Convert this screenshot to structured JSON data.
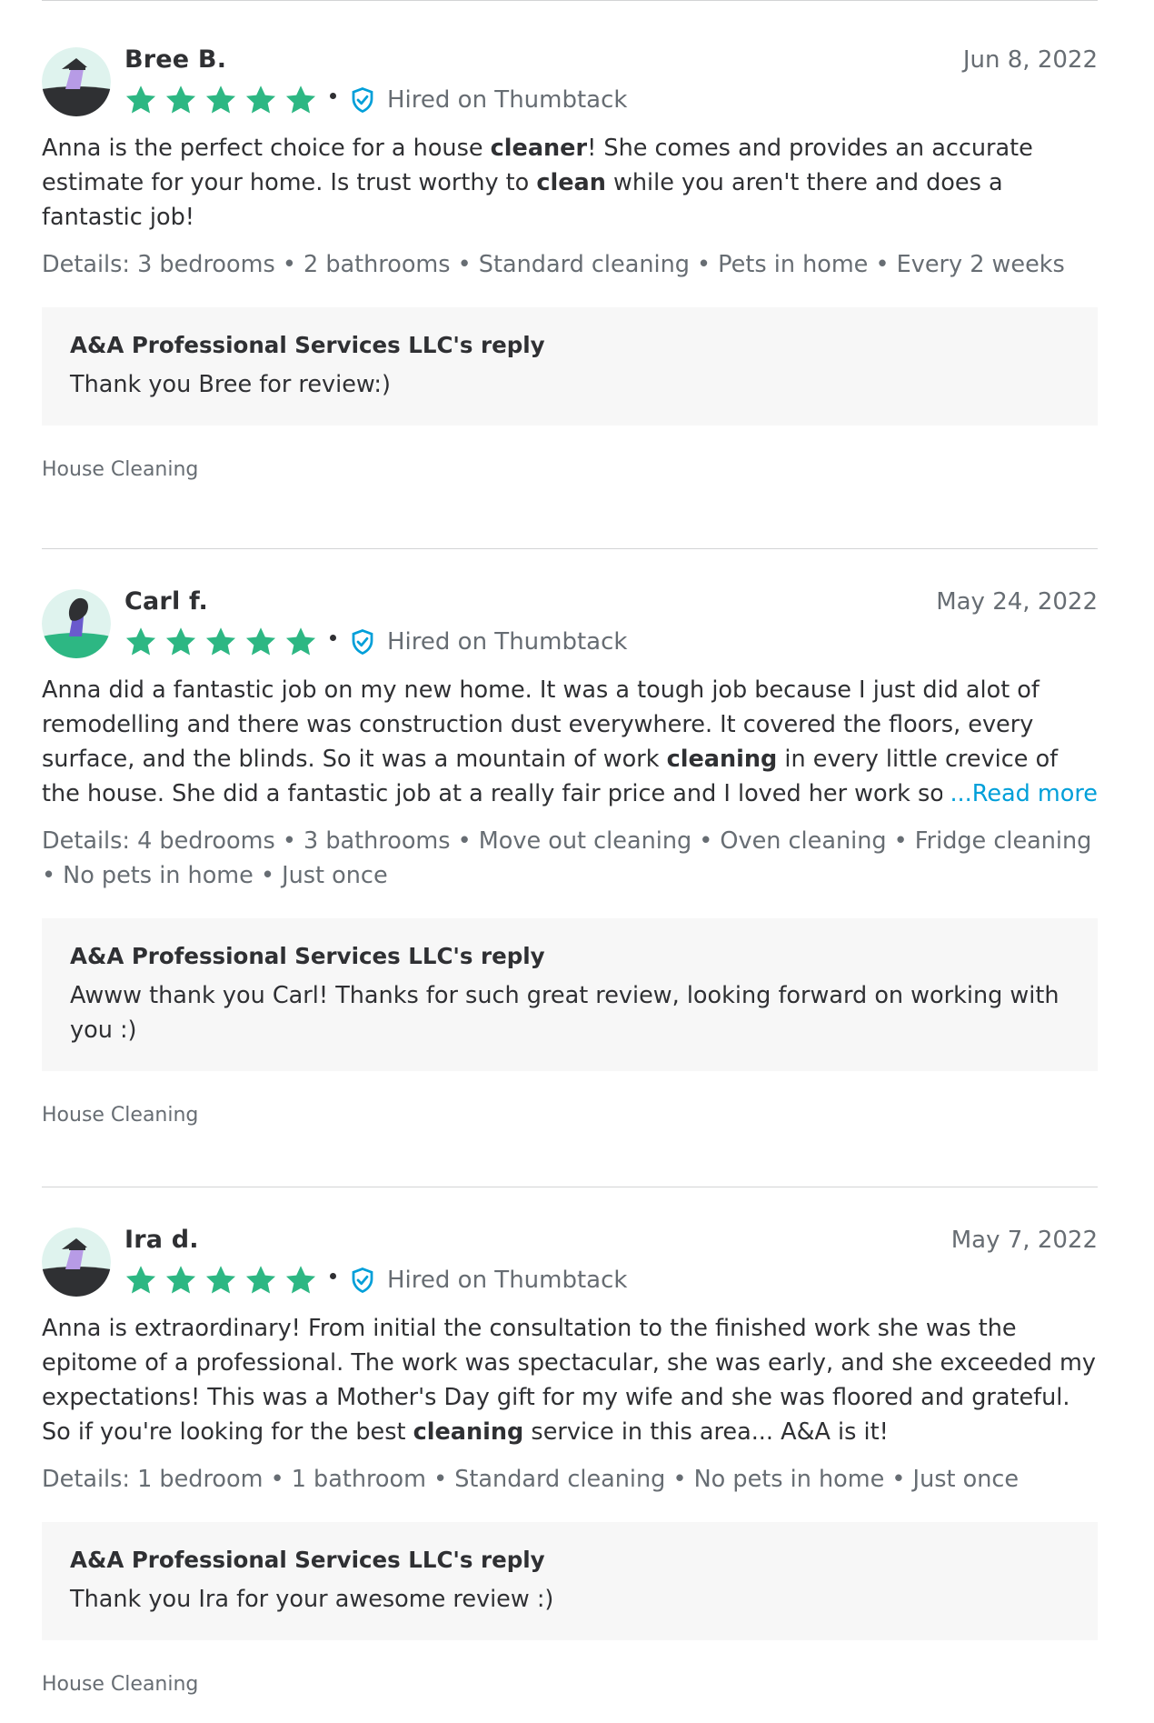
{
  "hired_label": "Hired on Thumbtack",
  "read_more": "...Read more",
  "colors": {
    "star": "#2db783",
    "verified": "#009fd9",
    "text": "#2f3033",
    "muted": "#676d73",
    "reply_bg": "#f7f7f7"
  },
  "reviews": [
    {
      "name": "Bree B.",
      "date": "Jun 8, 2022",
      "rating": 5,
      "body": [
        "Anna is the perfect choice for a house ",
        "cleaner",
        "! She comes and provides an accurate estimate for your home. Is trust worthy to ",
        "clean",
        " while you aren't there and does a fantastic job!"
      ],
      "details": "Details: 3 bedrooms • 2 bathrooms • Standard cleaning • Pets in home • Every 2 weeks",
      "reply_title": "A&A Professional Services LLC's reply",
      "reply_text": "Thank you Bree for review:)",
      "category": "House Cleaning"
    },
    {
      "name": "Carl f.",
      "date": "May 24, 2022",
      "rating": 5,
      "body": [
        "Anna did a fantastic job on my new home. It was a tough job because I just did alot of remodelling and there was construction dust everywhere. It covered the floors, every surface, and the blinds. So it was a mountain of work ",
        "cleaning",
        " in every little crevice of the house. She did a fantastic job at a really fair price and I loved her work so much"
      ],
      "details": "Details: 4 bedrooms • 3 bathrooms • Move out cleaning • Oven cleaning • Fridge cleaning • No pets in home • Just once",
      "reply_title": "A&A Professional Services LLC's reply",
      "reply_text": "Awww thank you Carl! Thanks for such great review, looking forward on working with you :)",
      "category": "House Cleaning"
    },
    {
      "name": "Ira d.",
      "date": "May 7, 2022",
      "rating": 5,
      "body": [
        "Anna is extraordinary! From initial the consultation to the finished work she was the epitome of a professional. The work was spectacular, she was early, and she exceeded my expectations! This was a Mother's Day gift for my wife and she was floored and grateful. So if you're looking for the best ",
        "cleaning",
        " service in this area... A&A is it!"
      ],
      "details": "Details: 1 bedroom • 1 bathroom • Standard cleaning • No pets in home • Just once",
      "reply_title": "A&A Professional Services LLC's reply",
      "reply_text": "Thank you Ira for your awesome review :)",
      "category": "House Cleaning"
    }
  ]
}
